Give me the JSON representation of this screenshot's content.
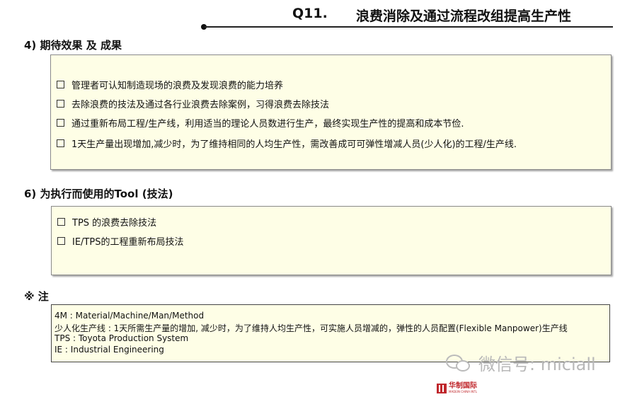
{
  "header": {
    "number": "Q11.",
    "title": "浪费消除及通过流程改组提高生产性"
  },
  "section4": {
    "heading": "4) 期待效果 及 成果",
    "items": [
      "管理者可认知制造现场的浪费及发现浪费的能力培养",
      "去除浪费的技法及通过各行业浪费去除案例，习得浪费去除技法",
      "通过重新布局工程/生产线，利用适当的理论人员数进行生产，最终实现生产性的提高和成本节俭.",
      "1天生产量出现增加,减少时，为了维持相同的人均生产性，需改善成可可弹性增减人员(少人化)的工程/生产线."
    ]
  },
  "section6": {
    "heading": "6) 为执行而使用的Tool (技法)",
    "items": [
      "TPS 的浪费去除技法",
      "IE/TPS的工程重新布局技法"
    ]
  },
  "notes": {
    "heading": "※ 注",
    "lines": [
      "4M : Material/Machine/Man/Method",
      "少人化生产线 : 1天所需生产量的增加, 减少时，为了维持人均生产性，可实施人员增减的，弹性的人员配置(Flexible Manpower)生产线",
      "TPS : Toyota Production System",
      " IE : Industrial Engineering"
    ]
  },
  "watermark": {
    "text": "微信号: miciall",
    "icon": "wechat-icon"
  },
  "logo": {
    "name": "华制国际",
    "sub": "MADEIN CHINA INTL",
    "color": "#c0282d"
  },
  "colors": {
    "panel_bg": "#fefee6",
    "border": "#8a8a8a"
  }
}
